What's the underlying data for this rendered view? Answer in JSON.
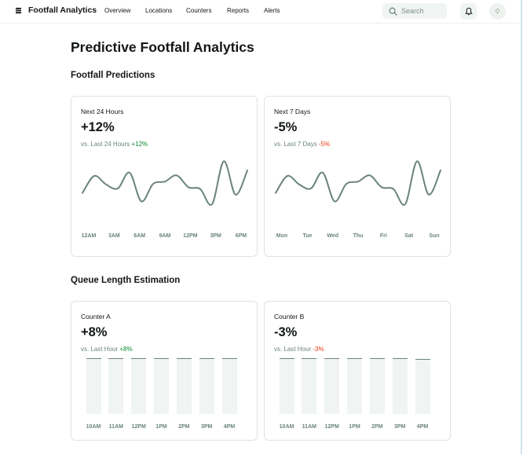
{
  "header": {
    "brand": "Footfall Analytics",
    "nav": [
      {
        "label": "Overview"
      },
      {
        "label": "Locations"
      },
      {
        "label": "Counters"
      },
      {
        "label": "Reports"
      },
      {
        "label": "Alerts"
      }
    ],
    "search_placeholder": "Search",
    "icons": {
      "search": "search-icon",
      "notifications": "bell-icon",
      "avatar": "avatar-icon",
      "brand": "logo-icon"
    }
  },
  "page": {
    "title": "Predictive Footfall Analytics",
    "sections": {
      "predictions": "Footfall Predictions",
      "queue": "Queue Length Estimation"
    }
  },
  "colors": {
    "accent": "#6b8577",
    "up": "#078a30",
    "down": "#e8380d",
    "bar_fill": "#f0f4f2"
  },
  "cards": {
    "next24": {
      "label": "Next 24 Hours",
      "value": "+12%",
      "compare": "vs. Last 24 Hours",
      "delta": "+12%"
    },
    "next7": {
      "label": "Next 7 Days",
      "value": "-5%",
      "compare": "vs. Last 7 Days",
      "delta": "-5%"
    },
    "counterA": {
      "label": "Counter A",
      "value": "+8%",
      "compare": "vs. Last Hour",
      "delta": "+8%"
    },
    "counterB": {
      "label": "Counter B",
      "value": "-3%",
      "compare": "vs. Last Hour",
      "delta": "-3%"
    }
  },
  "chart_data": [
    {
      "type": "line",
      "x": [
        "12AM",
        "3AM",
        "6AM",
        "9AM",
        "12PM",
        "3PM",
        "6PM"
      ],
      "values": [
        0.38,
        0.68,
        0.53,
        0.46,
        0.74,
        0.23,
        0.54,
        0.58,
        0.69,
        0.48,
        0.45,
        0.18,
        0.94,
        0.35,
        0.78
      ],
      "ylim": [
        0,
        1
      ]
    },
    {
      "type": "line",
      "x": [
        "Mon",
        "Tue",
        "Wed",
        "Thu",
        "Fri",
        "Sat",
        "Sun"
      ],
      "values": [
        0.38,
        0.68,
        0.53,
        0.46,
        0.74,
        0.23,
        0.54,
        0.58,
        0.69,
        0.48,
        0.45,
        0.18,
        0.94,
        0.35,
        0.78
      ],
      "ylim": [
        0,
        1
      ]
    },
    {
      "type": "bar",
      "categories": [
        "10AM",
        "11AM",
        "12PM",
        "1PM",
        "2PM",
        "3PM",
        "4PM"
      ],
      "values": [
        0.98,
        0.98,
        0.98,
        0.98,
        0.98,
        0.98,
        0.98
      ],
      "ylim": [
        0,
        1
      ]
    },
    {
      "type": "bar",
      "categories": [
        "10AM",
        "11AM",
        "12PM",
        "1PM",
        "2PM",
        "3PM",
        "4PM"
      ],
      "values": [
        0.98,
        0.98,
        0.98,
        0.98,
        0.98,
        0.98,
        0.97
      ],
      "ylim": [
        0,
        1
      ]
    }
  ]
}
